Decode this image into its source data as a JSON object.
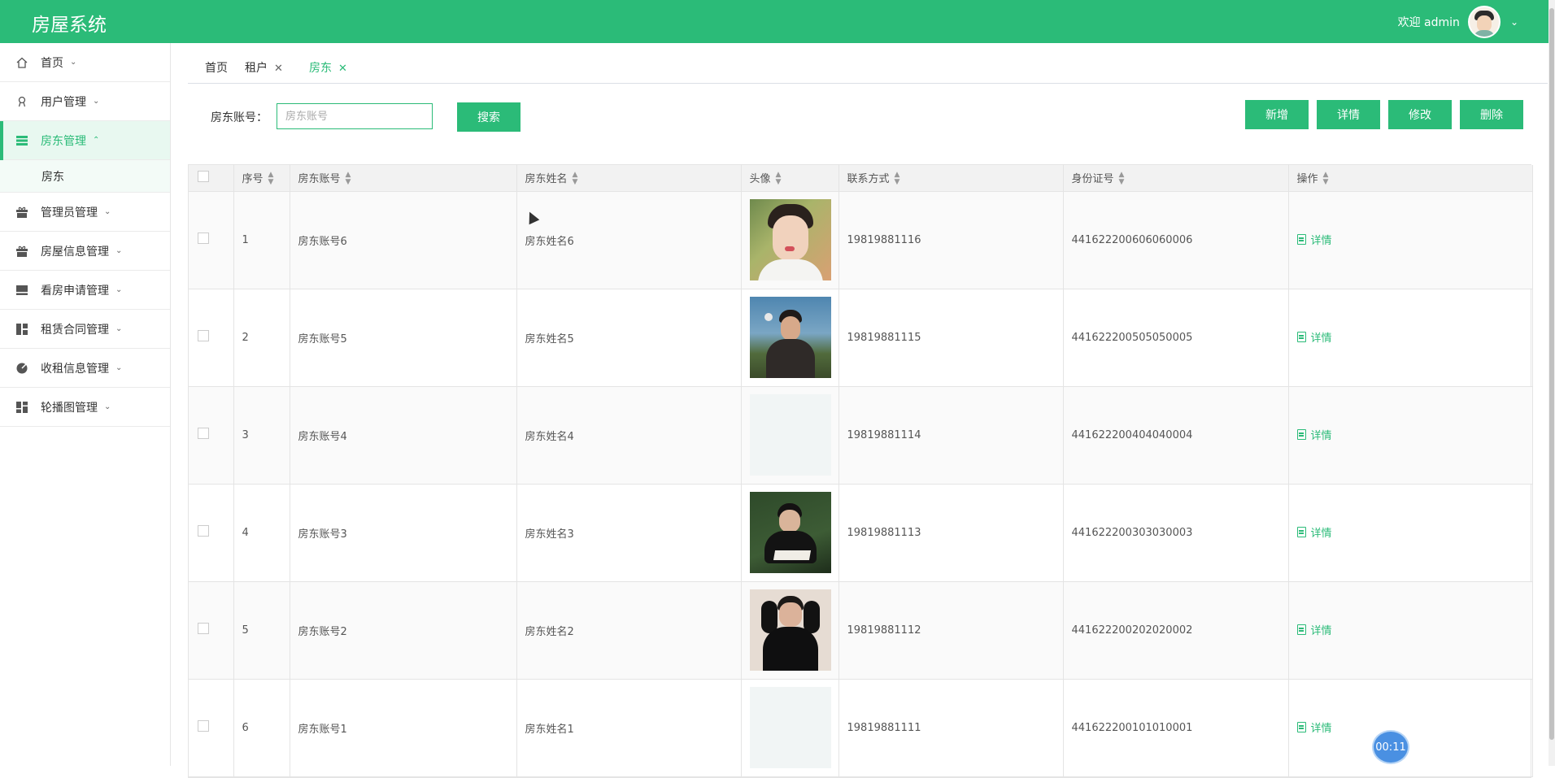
{
  "app": {
    "title": "房屋系统"
  },
  "header": {
    "welcome": "欢迎 admin"
  },
  "sidebar": {
    "items": [
      {
        "label": "首页",
        "icon": "home-icon"
      },
      {
        "label": "用户管理",
        "icon": "user-icon"
      },
      {
        "label": "房东管理",
        "icon": "list-icon",
        "active": true,
        "sub": [
          {
            "label": "房东"
          }
        ]
      },
      {
        "label": "管理员管理",
        "icon": "gift-icon"
      },
      {
        "label": "房屋信息管理",
        "icon": "gift-icon"
      },
      {
        "label": "看房申请管理",
        "icon": "monitor-icon"
      },
      {
        "label": "租赁合同管理",
        "icon": "dashboard-icon"
      },
      {
        "label": "收租信息管理",
        "icon": "pie-icon"
      },
      {
        "label": "轮播图管理",
        "icon": "dashboard-icon"
      }
    ]
  },
  "tabs": [
    {
      "label": "首页",
      "closable": false
    },
    {
      "label": "租户",
      "closable": true
    },
    {
      "label": "房东",
      "closable": true,
      "active": true
    }
  ],
  "search": {
    "label": "房东账号：",
    "placeholder": "房东账号",
    "button": "搜索"
  },
  "toolbar": {
    "add": "新增",
    "detail": "详情",
    "edit": "修改",
    "delete": "删除"
  },
  "table": {
    "headers": [
      "序号",
      "房东账号",
      "房东姓名",
      "头像",
      "联系方式",
      "身份证号",
      "操作"
    ],
    "rows": [
      {
        "no": "1",
        "account": "房东账号6",
        "name": "房东姓名6",
        "phone": "19819881116",
        "id": "441622200606060006",
        "action": "详情",
        "photo": "photo-1"
      },
      {
        "no": "2",
        "account": "房东账号5",
        "name": "房东姓名5",
        "phone": "19819881115",
        "id": "441622200505050005",
        "action": "详情",
        "photo": "photo-2"
      },
      {
        "no": "3",
        "account": "房东账号4",
        "name": "房东姓名4",
        "phone": "19819881114",
        "id": "441622200404040004",
        "action": "详情",
        "photo": "photo-3"
      },
      {
        "no": "4",
        "account": "房东账号3",
        "name": "房东姓名3",
        "phone": "19819881113",
        "id": "441622200303030003",
        "action": "详情",
        "photo": "photo-4"
      },
      {
        "no": "5",
        "account": "房东账号2",
        "name": "房东姓名2",
        "phone": "19819881112",
        "id": "441622200202020002",
        "action": "详情",
        "photo": "photo-5"
      },
      {
        "no": "6",
        "account": "房东账号1",
        "name": "房东姓名1",
        "phone": "19819881111",
        "id": "441622200101010001",
        "action": "详情",
        "photo": "photo-6"
      }
    ]
  },
  "timer": {
    "value": "00:11"
  },
  "colors": {
    "brand": "#2bbb78",
    "timer": "#4a90e2"
  }
}
